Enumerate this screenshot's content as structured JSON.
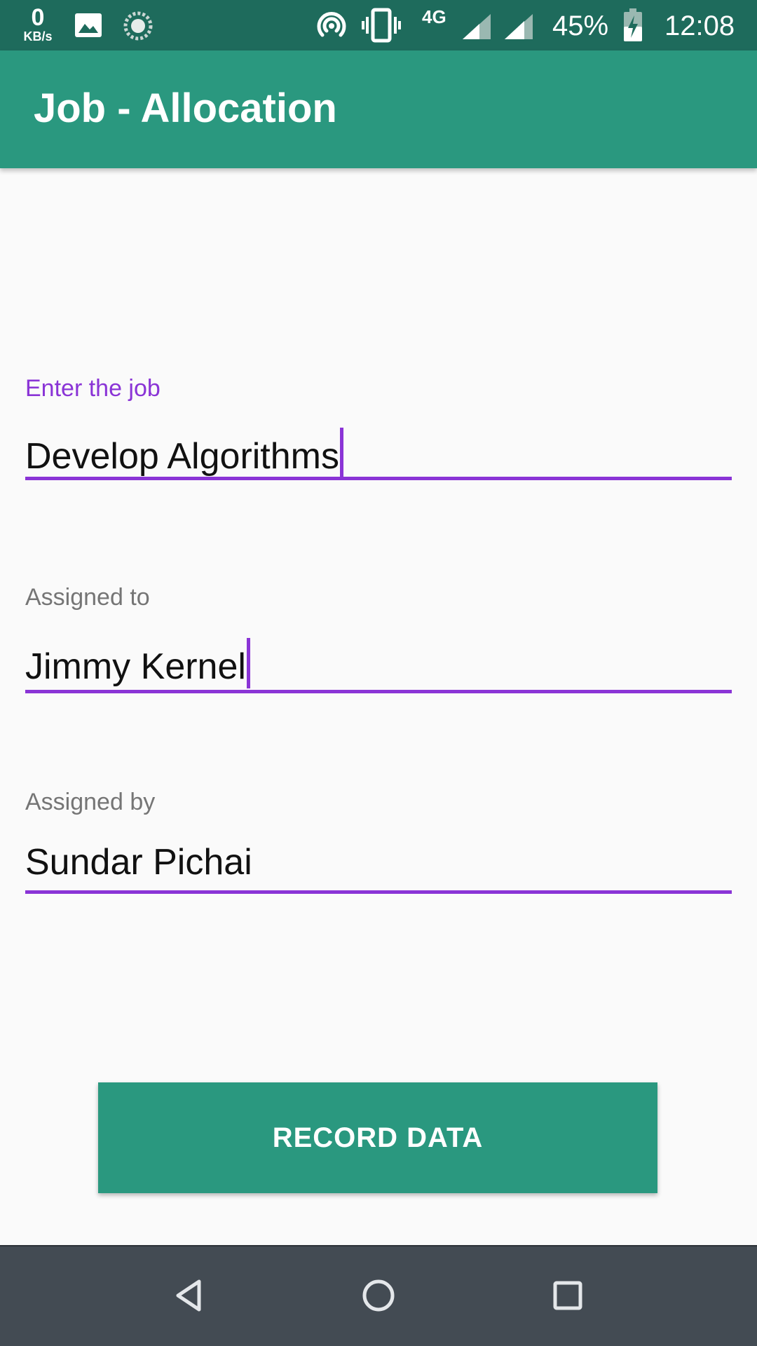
{
  "status_bar": {
    "speed_value": "0",
    "speed_unit": "KB/s",
    "network_type": "4G",
    "battery_percent": "45%",
    "time": "12:08",
    "icons": [
      "image-icon",
      "sync-icon",
      "hotspot-icon",
      "vibrate-icon",
      "signal-icon",
      "signal-icon",
      "battery-charging-icon"
    ]
  },
  "app_bar": {
    "title": "Job - Allocation",
    "color": "#2a987f"
  },
  "form": {
    "job": {
      "label": "Enter the job",
      "value": "Develop Algorithms",
      "focused": true
    },
    "assigned_to": {
      "label": "Assigned to",
      "value": "Jimmy Kernel"
    },
    "assigned_by": {
      "label": "Assigned by",
      "value": "Sundar Pichai"
    },
    "accent_color": "#8a34d6"
  },
  "actions": {
    "record_label": "RECORD DATA"
  },
  "nav_bar": {
    "icons": [
      "back-icon",
      "home-icon",
      "recents-icon"
    ]
  }
}
